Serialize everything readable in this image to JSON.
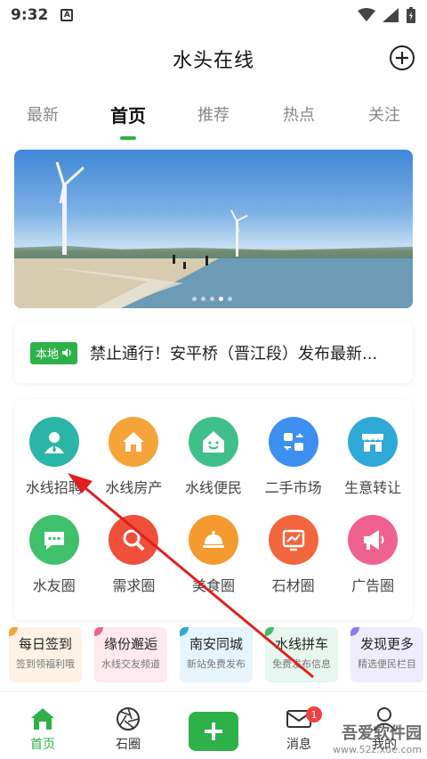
{
  "status_bar": {
    "time": "9:32",
    "notification_icon": "A"
  },
  "header": {
    "title": "水头在线",
    "add_icon": "plus-circle-icon"
  },
  "tabs": [
    {
      "label": "最新"
    },
    {
      "label": "首页",
      "active": true
    },
    {
      "label": "推荐"
    },
    {
      "label": "热点"
    },
    {
      "label": "关注"
    }
  ],
  "banner": {
    "dots": 5,
    "active_dot": 4
  },
  "notice": {
    "badge": "本地",
    "text": "禁止通行！安平桥（晋江段）发布最新..."
  },
  "services": [
    {
      "label": "水线招聘",
      "icon": "person-icon",
      "color": "#2bb5a6"
    },
    {
      "label": "水线房产",
      "icon": "house-icon",
      "color": "#f5a43a"
    },
    {
      "label": "水线便民",
      "icon": "smile-house-icon",
      "color": "#3fc08a"
    },
    {
      "label": "二手市场",
      "icon": "swap-icon",
      "color": "#3d8ff0"
    },
    {
      "label": "生意转让",
      "icon": "shop-icon",
      "color": "#2fa9d8"
    },
    {
      "label": "水友圈",
      "icon": "chat-icon",
      "color": "#3fc06a"
    },
    {
      "label": "需求圈",
      "icon": "search-icon",
      "color": "#f04f3b"
    },
    {
      "label": "美食圈",
      "icon": "food-cover-icon",
      "color": "#f59a2e"
    },
    {
      "label": "石材圈",
      "icon": "chart-icon",
      "color": "#f3653c"
    },
    {
      "label": "广告圈",
      "icon": "megaphone-icon",
      "color": "#f0628e"
    }
  ],
  "quick_links": [
    {
      "title": "每日签到",
      "subtitle": "签到领福利哦",
      "bg": "#fdf2e3",
      "corner": "#f5a43a"
    },
    {
      "title": "缘份邂逅",
      "subtitle": "水线交友频道",
      "bg": "#fde9ee",
      "corner": "#f0628e"
    },
    {
      "title": "南安同城",
      "subtitle": "新站免费发布",
      "bg": "#e5f5fb",
      "corner": "#2fa9d8"
    },
    {
      "title": "水线拼车",
      "subtitle": "免费发布信息",
      "bg": "#e7f6ee",
      "corner": "#3fc06a"
    },
    {
      "title": "发现更多",
      "subtitle": "精选便民栏目",
      "bg": "#eeedfb",
      "corner": "#8a7ef0"
    }
  ],
  "bottom_nav": [
    {
      "label": "首页",
      "icon": "home-icon",
      "active": true
    },
    {
      "label": "石圈",
      "icon": "aperture-icon"
    },
    {
      "label": "",
      "icon": "add-icon"
    },
    {
      "label": "消息",
      "icon": "mail-icon",
      "badge": "1"
    },
    {
      "label": "我的",
      "icon": "user-icon"
    }
  ],
  "watermark": {
    "line1": "吾爱软件园",
    "line2": "www.52z.xue.com"
  }
}
